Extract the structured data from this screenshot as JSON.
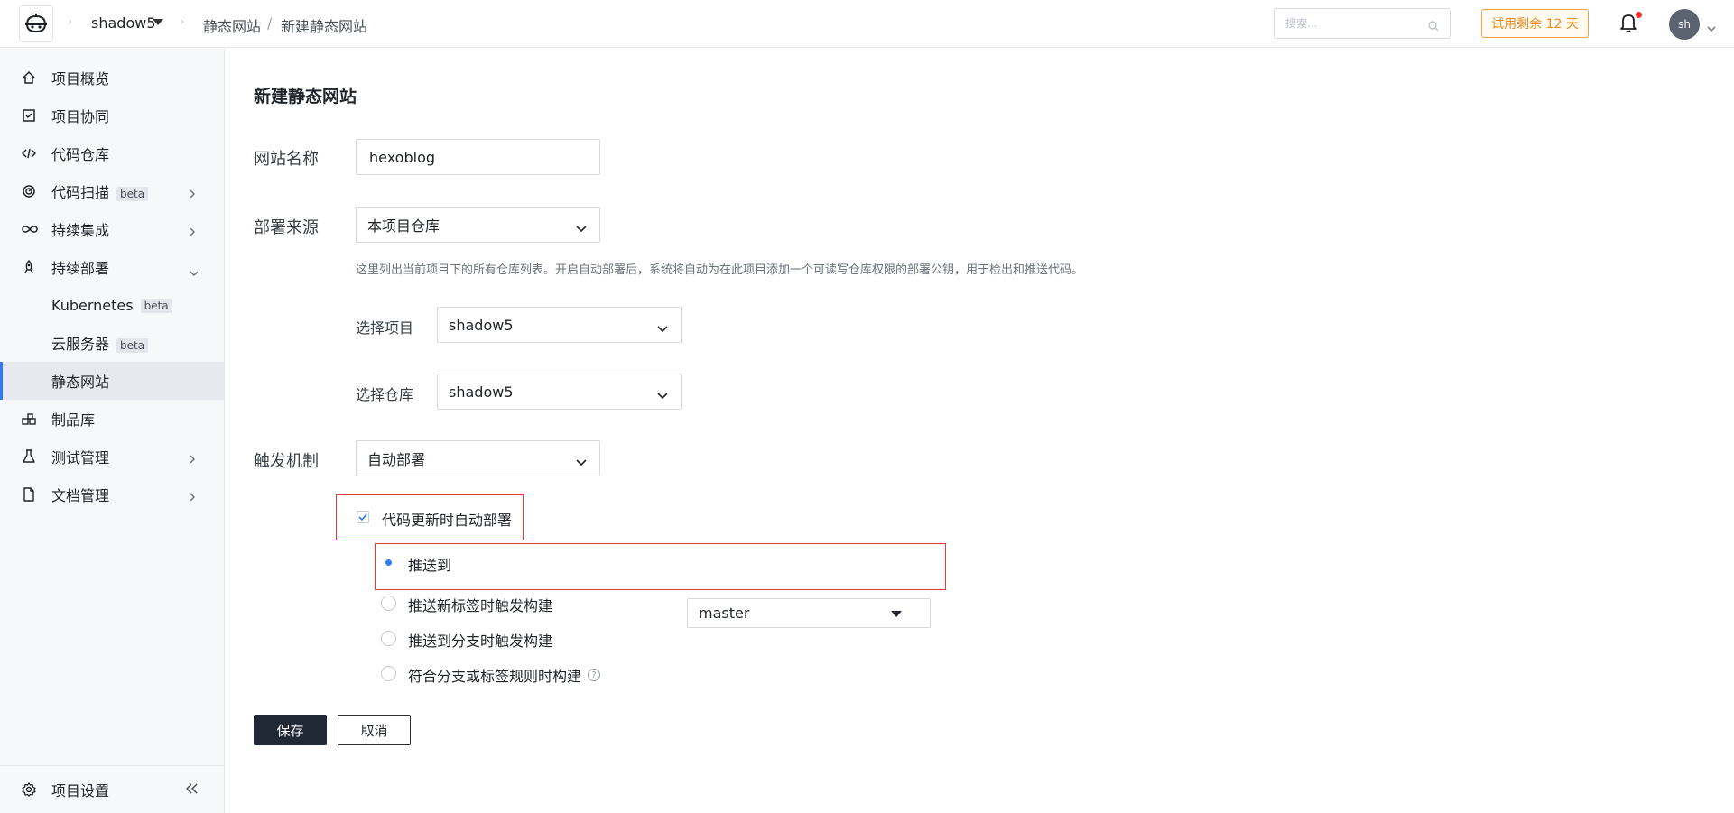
{
  "header": {
    "logo": "coding-logo-icon",
    "project": "shadow5",
    "breadcrumb": [
      "静态网站",
      "新建静态网站"
    ],
    "breadcrumb_separator": "/",
    "search_placeholder": "搜索...",
    "trial_label": "试用剩余 12 天",
    "avatar_initials": "sh"
  },
  "sidebar": {
    "items": [
      {
        "label": "项目概览",
        "icon": "home-icon"
      },
      {
        "label": "项目协同",
        "icon": "checkbox-icon"
      },
      {
        "label": "代码仓库",
        "icon": "code-icon"
      },
      {
        "label": "代码扫描",
        "icon": "scan-icon",
        "badge": "beta"
      },
      {
        "label": "持续集成",
        "icon": "infinity-icon"
      },
      {
        "label": "持续部署",
        "icon": "rocket-icon"
      },
      {
        "label": "Kubernetes",
        "badge": "beta"
      },
      {
        "label": "云服务器",
        "badge": "beta"
      },
      {
        "label": "静态网站",
        "active": true
      },
      {
        "label": "制品库",
        "icon": "package-icon"
      },
      {
        "label": "测试管理",
        "icon": "flask-icon"
      },
      {
        "label": "文档管理",
        "icon": "document-icon"
      }
    ],
    "settings_label": "项目设置"
  },
  "form": {
    "title": "新建静态网站",
    "site_name_label": "网站名称",
    "site_name_value": "hexoblog",
    "source_label": "部署来源",
    "source_value": "本项目仓库",
    "source_hint": "这里列出当前项目下的所有仓库列表。开启自动部署后，系统将自动为在此项目添加一个可读写仓库权限的部署公钥，用于检出和推送代码。",
    "project_label": "选择项目",
    "project_value": "shadow5",
    "repo_label": "选择仓库",
    "repo_value": "shadow5",
    "trigger_label": "触发机制",
    "trigger_value": "自动部署",
    "auto_deploy_label": "代码更新时自动部署",
    "auto_deploy_checked": true,
    "radio_options": [
      {
        "label": "推送到",
        "selected": true
      },
      {
        "label": "推送新标签时触发构建",
        "selected": false
      },
      {
        "label": "推送到分支时触发构建",
        "selected": false
      },
      {
        "label": "符合分支或标签规则时构建",
        "selected": false
      }
    ],
    "branch_value": "master",
    "save_label": "保存",
    "cancel_label": "取消"
  },
  "colors": {
    "accent": "#2b7cf6",
    "highlight_box": "#e5393b",
    "trial": "#f08c1a",
    "primary_button": "#202836"
  }
}
